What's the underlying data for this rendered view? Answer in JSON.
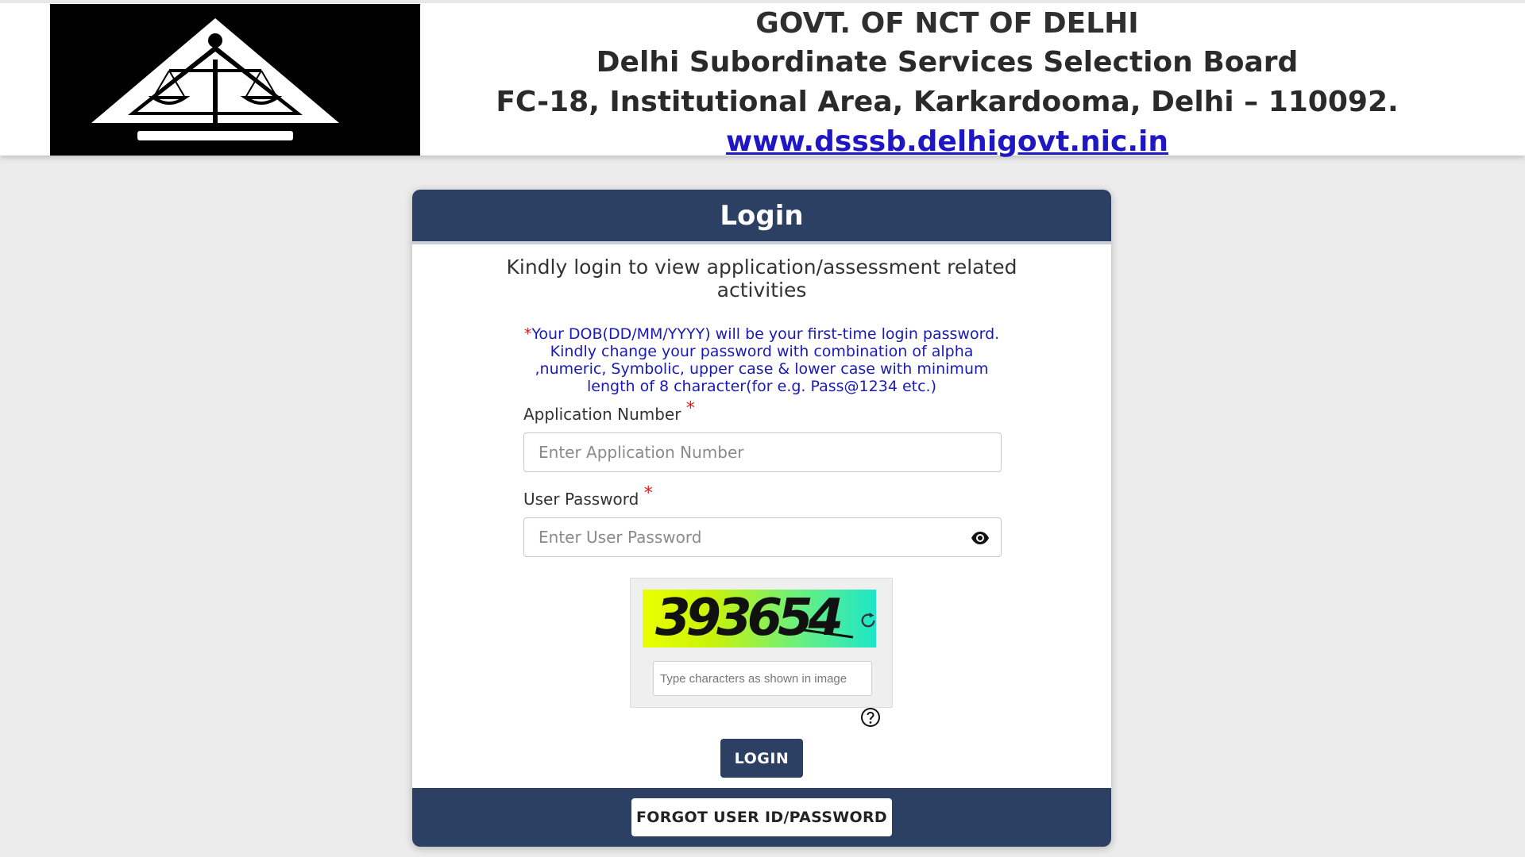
{
  "header": {
    "logo_icon": "dsssb-scales-of-justice-emblem",
    "line1": "GOVT. OF NCT OF DELHI",
    "line2": "Delhi Subordinate Services Selection Board",
    "line3": "FC-18, Institutional Area, Karkardooma, Delhi – 110092.",
    "website": "www.dsssb.delhigovt.nic.in"
  },
  "login": {
    "title": "Login",
    "intro": "Kindly login to view application/assessment related activities",
    "note_star": "*",
    "note": "Your DOB(DD/MM/YYYY) will be your first-time login password. Kindly change your password with combination of alpha ,numeric, Symbolic, upper case & lower case with minimum length of 8 character(for e.g. Pass@1234 etc.)",
    "app_number": {
      "label": "Application Number",
      "required": "*",
      "placeholder": "Enter Application Number",
      "value": ""
    },
    "password": {
      "label": "User Password",
      "required": "*",
      "placeholder": "Enter User Password",
      "value": "",
      "toggle_icon": "eye-icon"
    },
    "captcha": {
      "code": "393654",
      "refresh_icon": "refresh-icon",
      "placeholder": "Type characters as shown in image",
      "value": "",
      "help_icon": "question-circle-icon"
    },
    "login_button": "LOGIN",
    "forgot_button": "FORGOT USER ID/PASSWORD"
  },
  "colors": {
    "primary": "#2b4062",
    "link": "#1f17c4",
    "note": "#1a1ab8",
    "required": "#e11919",
    "page_bg": "#ececec"
  }
}
